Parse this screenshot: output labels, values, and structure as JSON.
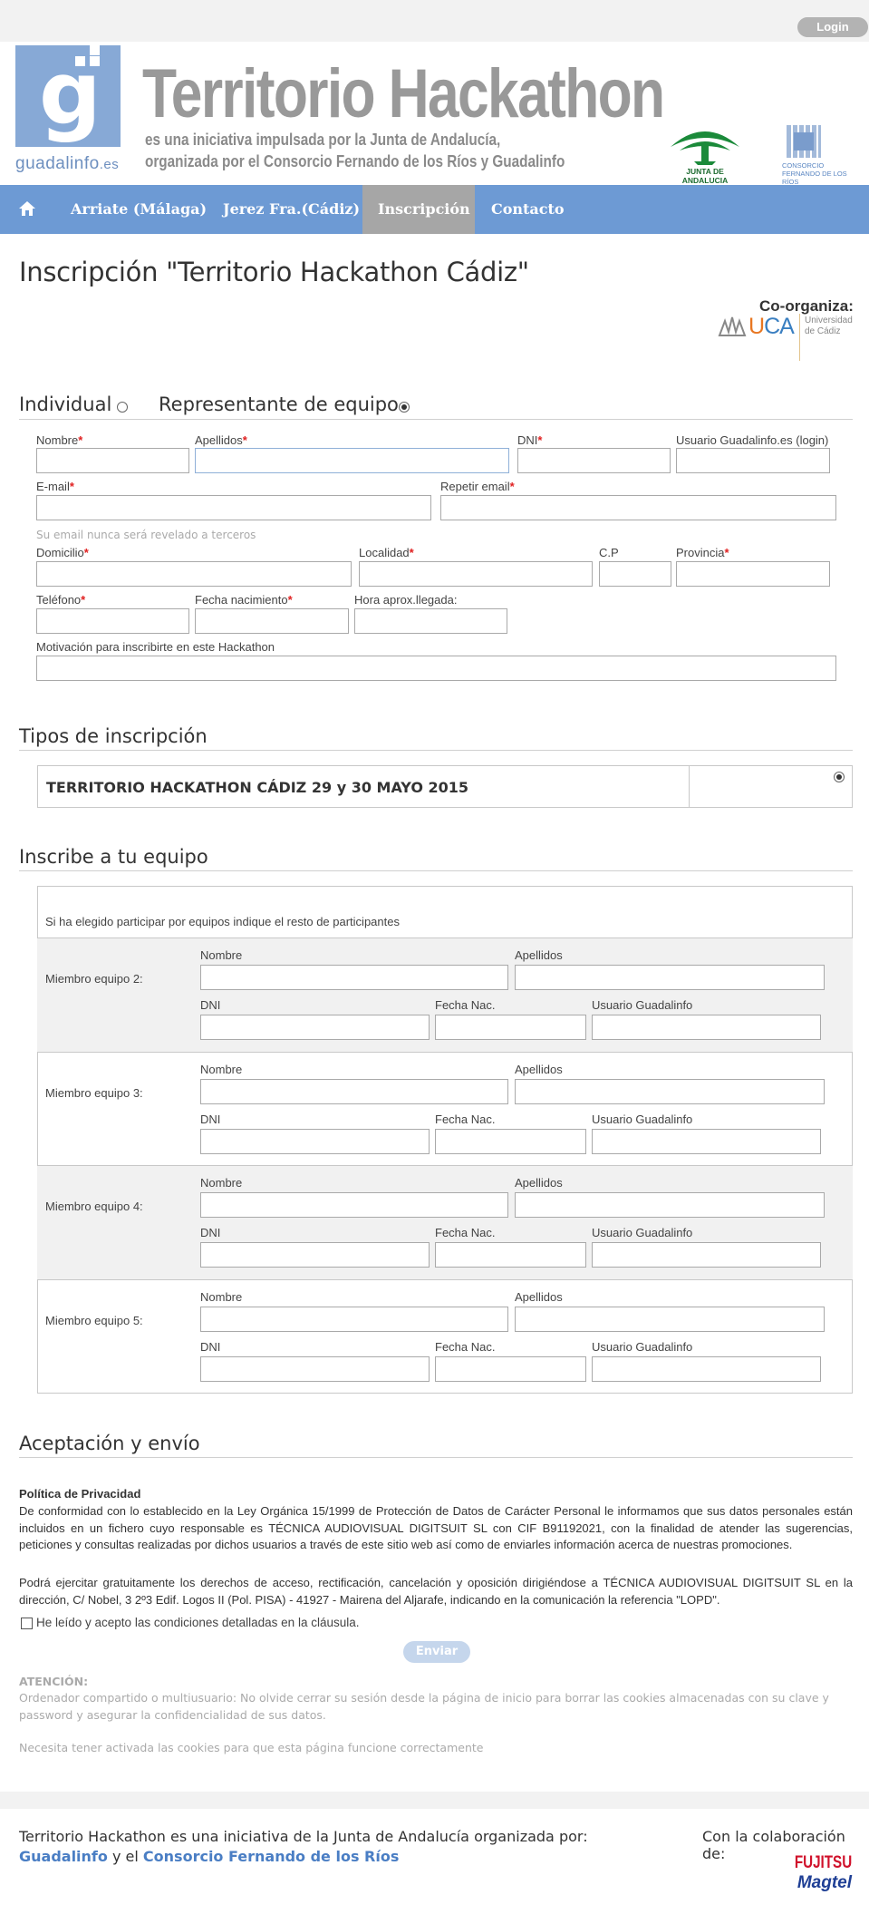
{
  "topbar": {
    "login_label": "Login"
  },
  "header": {
    "logo_text": "guadalinfo",
    "logo_suffix": ".es",
    "title": "Territorio Hackathon",
    "subtitle_line1": "es una iniciativa impulsada por la Junta de Andalucía,",
    "subtitle_line2": "organizada por el Consorcio Fernando de los Ríos y Guadalinfo",
    "junta_label": "JUNTA DE ANDALUCIA",
    "consorcio_label1": "CONSORCIO",
    "consorcio_label2": "FERNANDO DE LOS RÍOS"
  },
  "nav": {
    "items": [
      {
        "label": "Arriate (Málaga)"
      },
      {
        "label": "Jerez Fra.(Cádiz)"
      },
      {
        "label": "Inscripción",
        "active": true
      },
      {
        "label": "Contacto"
      }
    ]
  },
  "page": {
    "title": "Inscripción \"Territorio Hackathon Cádiz\"",
    "coorg_title": "Co-organiza:",
    "uca_label": "UCA",
    "uca_sub1": "Universidad",
    "uca_sub2": "de Cádiz"
  },
  "mode": {
    "individual_label": "Individual",
    "team_label": "Representante de equipo",
    "selected": "team"
  },
  "form": {
    "nombre": "Nombre",
    "apellidos": "Apellidos",
    "dni": "DNI",
    "usuario": "Usuario Guadalinfo.es (login)",
    "email": "E-mail",
    "repetir_email": "Repetir email",
    "email_note": "Su email nunca será revelado a terceros",
    "domicilio": "Domicilio",
    "localidad": "Localidad",
    "cp": "C.P",
    "provincia": "Provincia",
    "telefono": "Teléfono",
    "fecha_nacimiento": "Fecha nacimiento",
    "hora_llegada": "Hora aprox.llegada:",
    "motivacion": "Motivación para inscribirte en este Hackathon",
    "req_mark": "*"
  },
  "tipos": {
    "heading": "Tipos de inscripción",
    "option_label": "TERRITORIO HACKATHON CÁDIZ 29 y 30 MAYO 2015",
    "selected": true
  },
  "equipo": {
    "heading": "Inscribe a tu equipo",
    "intro": "Si ha elegido participar por equipos indique el resto de participantes",
    "field_nombre": "Nombre",
    "field_apellidos": "Apellidos",
    "field_dni": "DNI",
    "field_fecha": "Fecha Nac.",
    "field_usuario": "Usuario Guadalinfo",
    "members": [
      {
        "label": "Miembro equipo 2:"
      },
      {
        "label": "Miembro equipo 3:"
      },
      {
        "label": "Miembro equipo 4:"
      },
      {
        "label": "Miembro equipo 5:"
      }
    ]
  },
  "aceptacion": {
    "heading": "Aceptación y envío",
    "privacy_title": "Política de Privacidad",
    "privacy_p1": "De conformidad con lo establecido en la Ley Orgánica 15/1999 de Protección de Datos de Carácter Personal le informamos que sus datos personales están incluidos en un fichero cuyo responsable es TÉCNICA AUDIOVISUAL DIGITSUIT SL con CIF B91192021, con la finalidad de atender las sugerencias, peticiones y consultas realizadas por dichos usuarios a través de este sitio web así como de enviarles información acerca de nuestras promociones.",
    "privacy_p2": "Podrá ejercitar gratuitamente los derechos de acceso, rectificación, cancelación y oposición dirigiéndose a TÉCNICA AUDIOVISUAL DIGITSUIT SL en la dirección, C/ Nobel, 3 2º3 Edif. Logos II (Pol. PISA) - 41927 - Mairena del Aljarafe, indicando en la comunicación la referencia \"LOPD\".",
    "accept_label": "He leído y acepto las condiciones detalladas en la cláusula.",
    "send_label": "Enviar",
    "atencion_title": "ATENCIÓN:",
    "atencion_text": "Ordenador compartido o multiusuario: No olvide cerrar su sesión desde la página de inicio para borrar las cookies almacenadas con su clave y password y asegurar la confidencialidad de sus datos.",
    "cookies_text": "Necesita tener activada las cookies para que esta página funcione correctamente"
  },
  "footer": {
    "line1": "Territorio Hackathon es una iniciativa de la Junta de Andalucía organizada por:",
    "link1": "Guadalinfo",
    "connector": "y el",
    "link2": "Consorcio Fernando de los Ríos",
    "colab": "Con la colaboración de:",
    "fujitsu": "FUJITSU",
    "magtel": "Magtel"
  },
  "colors": {
    "nav_blue": "#6d9ad4",
    "nav_active": "#a6a6a6",
    "logo_blue": "#87a9d6",
    "link_blue": "#4a7ec4"
  }
}
